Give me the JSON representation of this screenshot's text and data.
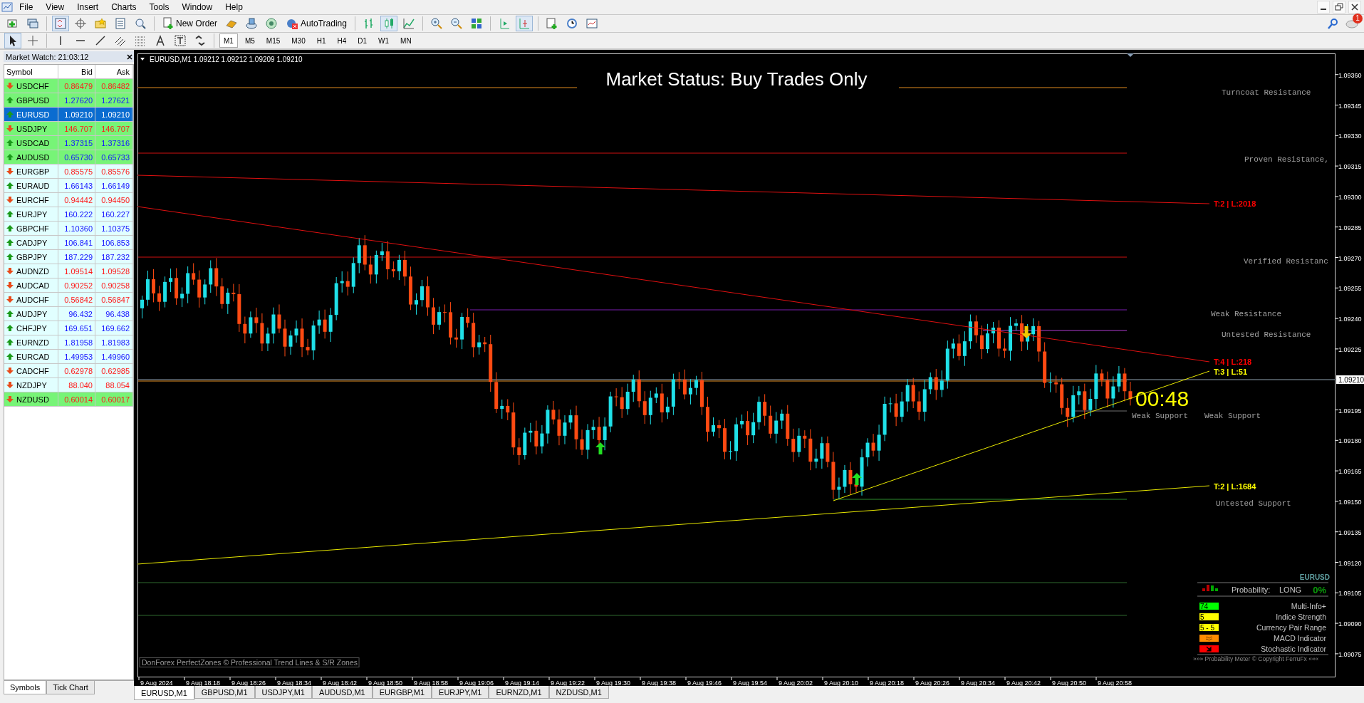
{
  "window": {
    "menu": [
      "File",
      "View",
      "Insert",
      "Charts",
      "Tools",
      "Window",
      "Help"
    ],
    "notification_count": "1"
  },
  "toolbar": {
    "new_order": "New Order",
    "autotrading": "AutoTrading",
    "timeframes": [
      {
        "label": "M1",
        "selected": true
      },
      {
        "label": "M5",
        "selected": false
      },
      {
        "label": "M15",
        "selected": false
      },
      {
        "label": "M30",
        "selected": false
      },
      {
        "label": "H1",
        "selected": false
      },
      {
        "label": "H4",
        "selected": false
      },
      {
        "label": "D1",
        "selected": false
      },
      {
        "label": "W1",
        "selected": false
      },
      {
        "label": "MN",
        "selected": false
      }
    ]
  },
  "market_watch": {
    "title": "Market Watch: 21:03:12",
    "columns": [
      "Symbol",
      "Bid",
      "Ask"
    ],
    "rows": [
      {
        "symbol": "USDCHF",
        "bid": "0.86479",
        "ask": "0.86482",
        "kind": "down",
        "highlighted": true,
        "selected": false
      },
      {
        "symbol": "GBPUSD",
        "bid": "1.27620",
        "ask": "1.27621",
        "kind": "up",
        "highlighted": true,
        "selected": false
      },
      {
        "symbol": "EURUSD",
        "bid": "1.09210",
        "ask": "1.09210",
        "kind": "up",
        "highlighted": false,
        "selected": true
      },
      {
        "symbol": "USDJPY",
        "bid": "146.707",
        "ask": "146.707",
        "kind": "down",
        "highlighted": true,
        "selected": false
      },
      {
        "symbol": "USDCAD",
        "bid": "1.37315",
        "ask": "1.37316",
        "kind": "up",
        "highlighted": true,
        "selected": false
      },
      {
        "symbol": "AUDUSD",
        "bid": "0.65730",
        "ask": "0.65733",
        "kind": "up",
        "highlighted": true,
        "selected": false
      },
      {
        "symbol": "EURGBP",
        "bid": "0.85575",
        "ask": "0.85576",
        "kind": "down",
        "highlighted": false,
        "selected": false
      },
      {
        "symbol": "EURAUD",
        "bid": "1.66143",
        "ask": "1.66149",
        "kind": "up",
        "highlighted": false,
        "selected": false
      },
      {
        "symbol": "EURCHF",
        "bid": "0.94442",
        "ask": "0.94450",
        "kind": "down",
        "highlighted": false,
        "selected": false
      },
      {
        "symbol": "EURJPY",
        "bid": "160.222",
        "ask": "160.227",
        "kind": "up",
        "highlighted": false,
        "selected": false
      },
      {
        "symbol": "GBPCHF",
        "bid": "1.10360",
        "ask": "1.10375",
        "kind": "up",
        "highlighted": false,
        "selected": false
      },
      {
        "symbol": "CADJPY",
        "bid": "106.841",
        "ask": "106.853",
        "kind": "up",
        "highlighted": false,
        "selected": false
      },
      {
        "symbol": "GBPJPY",
        "bid": "187.229",
        "ask": "187.232",
        "kind": "up",
        "highlighted": false,
        "selected": false
      },
      {
        "symbol": "AUDNZD",
        "bid": "1.09514",
        "ask": "1.09528",
        "kind": "down",
        "highlighted": false,
        "selected": false
      },
      {
        "symbol": "AUDCAD",
        "bid": "0.90252",
        "ask": "0.90258",
        "kind": "down",
        "highlighted": false,
        "selected": false
      },
      {
        "symbol": "AUDCHF",
        "bid": "0.56842",
        "ask": "0.56847",
        "kind": "down",
        "highlighted": false,
        "selected": false
      },
      {
        "symbol": "AUDJPY",
        "bid": "96.432",
        "ask": "96.438",
        "kind": "up",
        "highlighted": false,
        "selected": false
      },
      {
        "symbol": "CHFJPY",
        "bid": "169.651",
        "ask": "169.662",
        "kind": "up",
        "highlighted": false,
        "selected": false
      },
      {
        "symbol": "EURNZD",
        "bid": "1.81958",
        "ask": "1.81983",
        "kind": "up",
        "highlighted": false,
        "selected": false
      },
      {
        "symbol": "EURCAD",
        "bid": "1.49953",
        "ask": "1.49960",
        "kind": "up",
        "highlighted": false,
        "selected": false
      },
      {
        "symbol": "CADCHF",
        "bid": "0.62978",
        "ask": "0.62985",
        "kind": "down",
        "highlighted": false,
        "selected": false
      },
      {
        "symbol": "NZDJPY",
        "bid": "88.040",
        "ask": "88.054",
        "kind": "down",
        "highlighted": false,
        "selected": false
      },
      {
        "symbol": "NZDUSD",
        "bid": "0.60014",
        "ask": "0.60017",
        "kind": "down",
        "highlighted": true,
        "selected": false
      }
    ],
    "tabs": [
      {
        "label": "Symbols",
        "selected": true
      },
      {
        "label": "Tick Chart",
        "selected": false
      }
    ]
  },
  "chart": {
    "title": "EURUSD,M1  1.09212 1.09212 1.09209 1.09210",
    "status": "Market Status: Buy Trades Only",
    "price_axis": [
      "1.09360",
      "1.09345",
      "1.09330",
      "1.09315",
      "1.09300",
      "1.09285",
      "1.09270",
      "1.09255",
      "1.09240",
      "1.09225",
      "1.09195",
      "1.09180",
      "1.09165",
      "1.09150",
      "1.09135",
      "1.09120",
      "1.09105",
      "1.09090",
      "1.09075"
    ],
    "current_price": "1.09210",
    "time_axis": [
      "9 Aug 2024",
      "9 Aug 18:18",
      "9 Aug 18:26",
      "9 Aug 18:34",
      "9 Aug 18:42",
      "9 Aug 18:50",
      "9 Aug 18:58",
      "9 Aug 19:06",
      "9 Aug 19:14",
      "9 Aug 19:22",
      "9 Aug 19:30",
      "9 Aug 19:38",
      "9 Aug 19:46",
      "9 Aug 19:54",
      "9 Aug 20:02",
      "9 Aug 20:10",
      "9 Aug 20:18",
      "9 Aug 20:26",
      "9 Aug 20:34",
      "9 Aug 20:42",
      "9 Aug 20:50",
      "9 Aug 20:58"
    ],
    "zone_labels": [
      "Turncoat Resistance",
      "Proven Resistance,",
      "Verified Resistanc",
      "Weak Resistance",
      "Untested Resistance",
      "Weak Support",
      "Weak Support",
      "Untested Support"
    ],
    "trendline_labels": [
      {
        "text": "T:2 | L:2018",
        "color": "#ff0000"
      },
      {
        "text": "T:4 | L:218",
        "color": "#ff0000"
      },
      {
        "text": "T:3 | L:51",
        "color": "#ffff00"
      },
      {
        "text": "T:2 | L:1684",
        "color": "#ffff00"
      }
    ],
    "countdown": "00:48",
    "footer": "DonForex PerfectZones © Professional Trend Lines & S/R Zones",
    "probability_meter": {
      "symbol": "EURUSD",
      "label": "Probability:",
      "direction": "LONG",
      "value": "0%",
      "indicators": [
        {
          "kind": "text",
          "value": "74",
          "name": "Multi-Info+",
          "color": "#00ff00"
        },
        {
          "kind": "text",
          "value": "5",
          "name": "Indice Strength",
          "color": "#ffff00"
        },
        {
          "kind": "text",
          "value": "5 - 5",
          "name": "Currency Pair Range",
          "color": "#ffff00"
        },
        {
          "kind": "wave",
          "name": "MACD Indicator",
          "color": "#ff8c00"
        },
        {
          "kind": "arrow",
          "name": "Stochastic Indicator",
          "color": "#ff0000"
        }
      ],
      "copyright": "»»» Probability Meter © Copyright FerruFx «««"
    }
  },
  "chart_tabs": [
    {
      "label": "EURUSD,M1",
      "selected": true
    },
    {
      "label": "GBPUSD,M1",
      "selected": false
    },
    {
      "label": "USDJPY,M1",
      "selected": false
    },
    {
      "label": "AUDUSD,M1",
      "selected": false
    },
    {
      "label": "EURGBP,M1",
      "selected": false
    },
    {
      "label": "EURJPY,M1",
      "selected": false
    },
    {
      "label": "EURNZD,M1",
      "selected": false
    },
    {
      "label": "NZDUSD,M1",
      "selected": false
    }
  ]
}
